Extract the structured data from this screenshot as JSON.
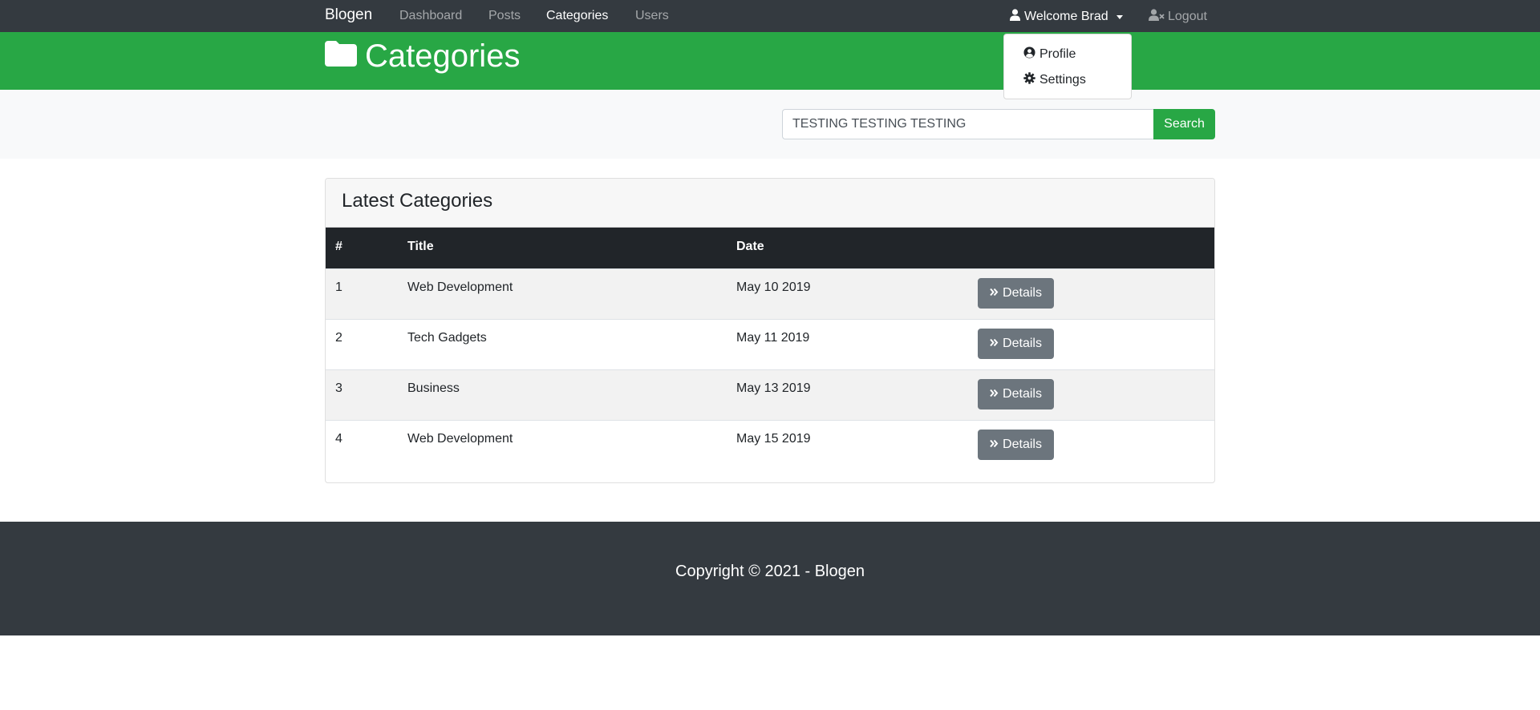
{
  "navbar": {
    "brand": "Blogen",
    "links": [
      {
        "label": "Dashboard",
        "active": false
      },
      {
        "label": "Posts",
        "active": false
      },
      {
        "label": "Categories",
        "active": true
      },
      {
        "label": "Users",
        "active": false
      }
    ],
    "user_label": "Welcome Brad",
    "logout_label": "Logout"
  },
  "dropdown": {
    "items": [
      {
        "label": "Profile",
        "icon": "user-circle-icon"
      },
      {
        "label": "Settings",
        "icon": "gear-icon"
      }
    ]
  },
  "header": {
    "title": "Categories",
    "icon": "folder-icon"
  },
  "search": {
    "value": "TESTING TESTING TESTING",
    "button_label": "Search"
  },
  "card": {
    "title": "Latest Categories",
    "columns": [
      "#",
      "Title",
      "Date",
      ""
    ],
    "rows": [
      {
        "num": "1",
        "title": "Web Development",
        "date": "May 10 2019",
        "action": "Details"
      },
      {
        "num": "2",
        "title": "Tech Gadgets",
        "date": "May 11 2019",
        "action": "Details"
      },
      {
        "num": "3",
        "title": "Business",
        "date": "May 13 2019",
        "action": "Details"
      },
      {
        "num": "4",
        "title": "Web Development",
        "date": "May 15 2019",
        "action": "Details"
      }
    ]
  },
  "footer": {
    "text": "Copyright © 2021 - Blogen"
  },
  "colors": {
    "navbar": "#343a40",
    "header": "#28a745",
    "search_button": "#28a745",
    "table_header": "#212529",
    "details_button": "#6c757d",
    "footer": "#343a40"
  }
}
